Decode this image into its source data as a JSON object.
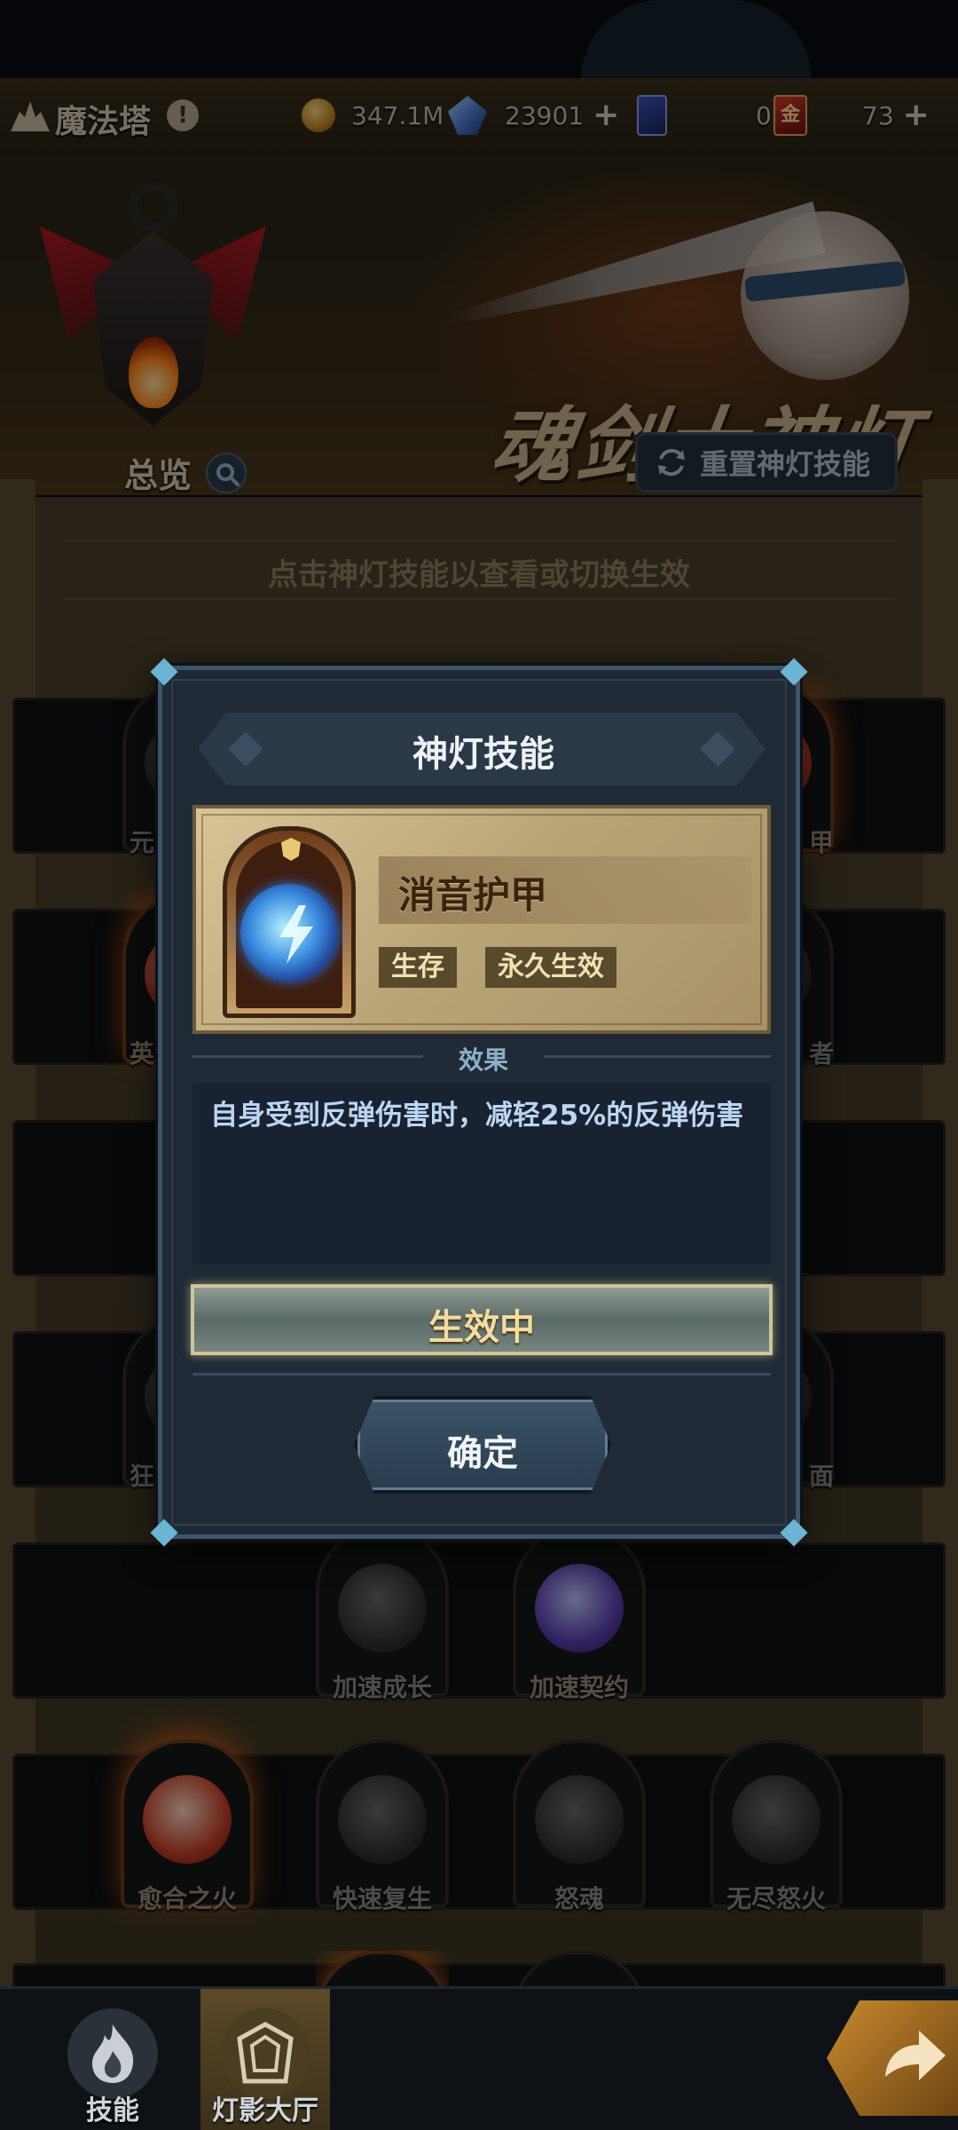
{
  "header": {
    "tower_title": "魔法塔",
    "info_mark": "!",
    "resources": [
      {
        "icon": "gold-coin-icon",
        "value": "347.1M",
        "has_plus": false
      },
      {
        "icon": "crystal-icon",
        "value": "23901",
        "has_plus": true
      },
      {
        "icon": "card-ticket-icon",
        "value": "0",
        "has_plus": false
      },
      {
        "icon": "gold-ticket-icon",
        "value": "73",
        "has_plus": true
      }
    ],
    "gold_ticket_glyph": "金",
    "plus_glyph": "+"
  },
  "banner": {
    "title": "魂剑士神灯",
    "overview_label": "总览",
    "reset_button_label": "重置神灯技能"
  },
  "hint_text": "点击神灯技能以查看或切换生效",
  "nodes": [
    {
      "label": "加速成长",
      "style": "gray"
    },
    {
      "label": "加速契约",
      "style": "blue"
    },
    {
      "label": "愈合之火",
      "style": "fire"
    },
    {
      "label": "快速复生",
      "style": "gray"
    },
    {
      "label": "怒魂",
      "style": "gray"
    },
    {
      "label": "无尽怒火",
      "style": "gray"
    }
  ],
  "side_labels": [
    "元",
    "甲",
    "英",
    "者",
    "狂",
    "面"
  ],
  "modal": {
    "title": "神灯技能",
    "skill_name": "消音护甲",
    "tags": [
      "生存",
      "永久生效"
    ],
    "effect_header": "效果",
    "effect_text": "自身受到反弹伤害时，减轻25%的反弹伤害",
    "status_button_label": "生效中",
    "confirm_button_label": "确定"
  },
  "bottom_nav": [
    {
      "label": "技能",
      "icon": "flame-icon",
      "active": false
    },
    {
      "label": "灯影大厅",
      "icon": "hall-icon",
      "active": true
    }
  ],
  "colors": {
    "modal_bg": "#1f2a36",
    "effect_text": "#bcd6f2",
    "skill_card": "#d8c497",
    "nav_active": "#5c4a27"
  }
}
